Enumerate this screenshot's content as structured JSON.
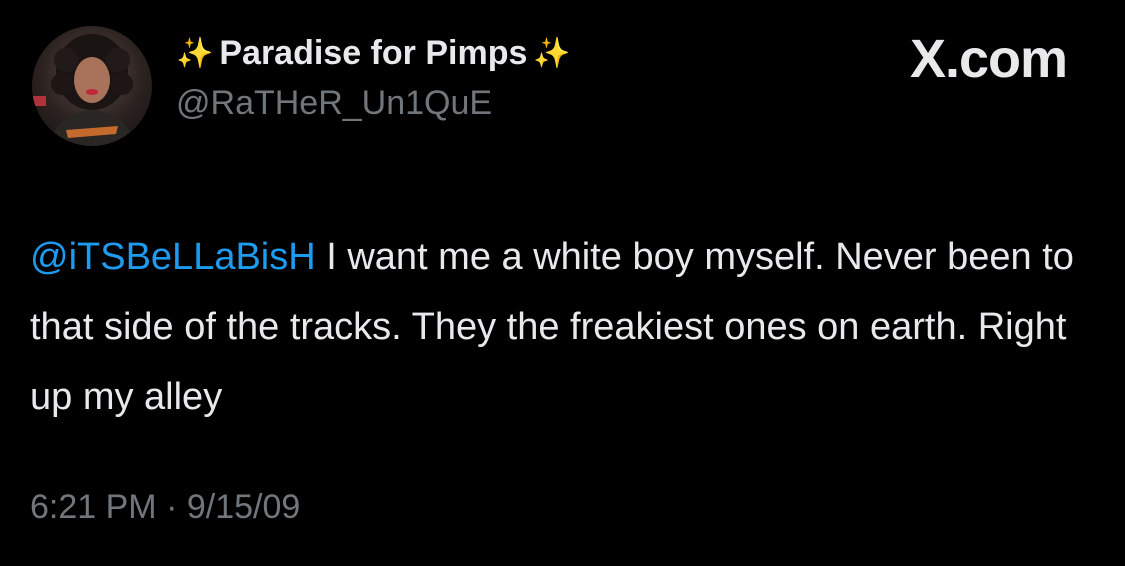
{
  "author": {
    "display_name": "Paradise for Pimps",
    "sparkle_left": "✨",
    "sparkle_right": "✨",
    "handle": "@RaTHeR_Un1QuE",
    "avatar_icon": "profile-photo"
  },
  "brand": {
    "label": "X.com"
  },
  "tweet": {
    "mention": "@iTSBeLLaBisH",
    "text": " I want me a white boy myself. Never been to that side of the tracks. They the freakiest ones on earth. Right up my alley",
    "timestamp": "6:21 PM · 9/15/09"
  },
  "colors": {
    "background": "#000000",
    "text": "#e7e9ea",
    "muted": "#71767b",
    "link": "#1d9bf0",
    "sparkle": "#f5c73a"
  }
}
